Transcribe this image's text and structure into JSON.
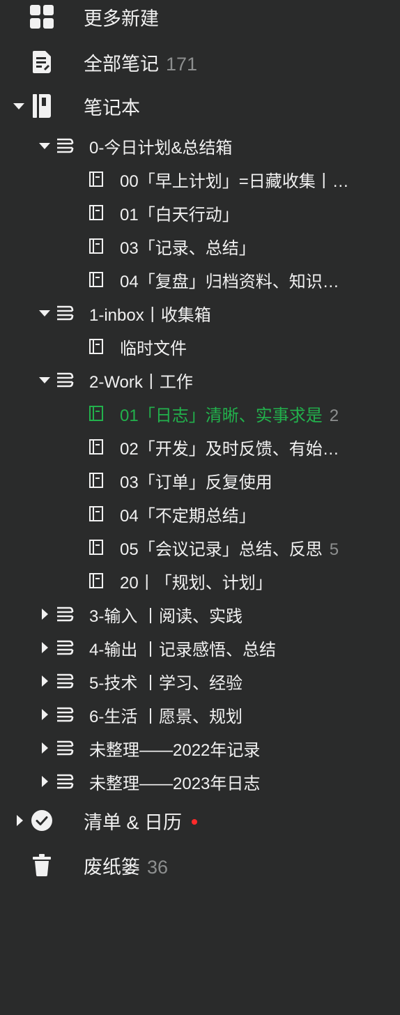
{
  "sidebar": {
    "more_new": {
      "label": "更多新建"
    },
    "all_notes": {
      "label": "全部笔记",
      "count": "171"
    },
    "notebooks": {
      "label": "笔记本"
    },
    "groups": [
      {
        "label": "0-今日计划&总结箱",
        "expanded": true,
        "items": [
          {
            "label": "00「早上计划」=日藏收集丨…"
          },
          {
            "label": "01「白天行动」"
          },
          {
            "label": "03「记录、总结」"
          },
          {
            "label": "04「复盘」归档资料、知识…"
          }
        ]
      },
      {
        "label": "1-inbox丨收集箱",
        "expanded": true,
        "items": [
          {
            "label": "临时文件"
          }
        ]
      },
      {
        "label": "2-Work丨工作",
        "expanded": true,
        "items": [
          {
            "label": "01「日志」清晰、实事求是",
            "count": "2",
            "active": true
          },
          {
            "label": "02「开发」及时反馈、有始…"
          },
          {
            "label": "03「订单」反复使用"
          },
          {
            "label": "04「不定期总结」"
          },
          {
            "label": "05「会议记录」总结、反思",
            "count": "5"
          },
          {
            "label": "20丨「规划、计划」"
          }
        ]
      },
      {
        "label": "3-输入 丨阅读、实践",
        "expanded": false
      },
      {
        "label": "4-输出 丨记录感悟、总结",
        "expanded": false
      },
      {
        "label": "5-技术 丨学习、经验",
        "expanded": false
      },
      {
        "label": "6-生活 丨愿景、规划",
        "expanded": false
      },
      {
        "label": "未整理——2022年记录",
        "expanded": false
      },
      {
        "label": "未整理——2023年日志",
        "expanded": false
      }
    ],
    "checklist": {
      "label": "清单 & 日历",
      "has_notification": true
    },
    "trash": {
      "label": "废纸篓",
      "count": "36"
    }
  },
  "colors": {
    "background": "#2a2b2b",
    "text": "#f1f1f1",
    "muted": "#8d8f8f",
    "active": "#22b14c",
    "notification": "#ff2a2a"
  }
}
